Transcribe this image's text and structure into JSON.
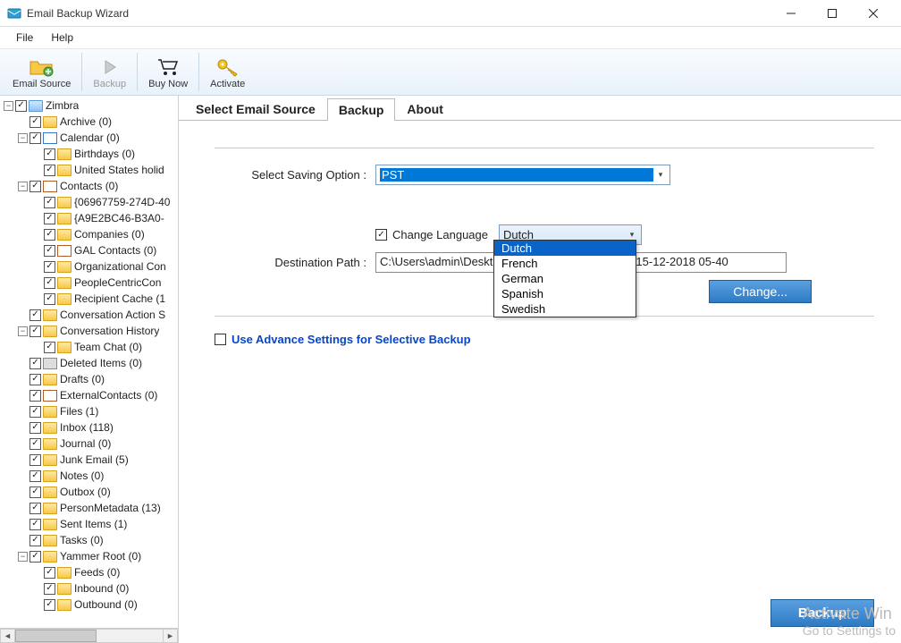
{
  "window": {
    "title": "Email Backup Wizard"
  },
  "menu": {
    "file": "File",
    "help": "Help"
  },
  "toolbar": {
    "email_source": "Email Source",
    "backup": "Backup",
    "buy_now": "Buy Now",
    "activate": "Activate"
  },
  "tree": [
    {
      "indent": 0,
      "exp": "-",
      "icon": "folder-blue",
      "label": "Zimbra"
    },
    {
      "indent": 1,
      "exp": " ",
      "icon": "folder",
      "label": "Archive (0)"
    },
    {
      "indent": 1,
      "exp": "-",
      "icon": "calendar",
      "label": "Calendar (0)"
    },
    {
      "indent": 2,
      "exp": " ",
      "icon": "folder",
      "label": "Birthdays (0)"
    },
    {
      "indent": 2,
      "exp": " ",
      "icon": "folder",
      "label": "United States holid"
    },
    {
      "indent": 1,
      "exp": "-",
      "icon": "contacts",
      "label": "Contacts (0)"
    },
    {
      "indent": 2,
      "exp": " ",
      "icon": "folder",
      "label": "{06967759-274D-40"
    },
    {
      "indent": 2,
      "exp": " ",
      "icon": "folder",
      "label": "{A9E2BC46-B3A0-"
    },
    {
      "indent": 2,
      "exp": " ",
      "icon": "folder",
      "label": "Companies (0)"
    },
    {
      "indent": 2,
      "exp": " ",
      "icon": "contacts",
      "label": "GAL Contacts (0)"
    },
    {
      "indent": 2,
      "exp": " ",
      "icon": "folder",
      "label": "Organizational Con"
    },
    {
      "indent": 2,
      "exp": " ",
      "icon": "folder",
      "label": "PeopleCentricCon"
    },
    {
      "indent": 2,
      "exp": " ",
      "icon": "folder",
      "label": "Recipient Cache (1"
    },
    {
      "indent": 1,
      "exp": " ",
      "icon": "folder",
      "label": "Conversation Action S"
    },
    {
      "indent": 1,
      "exp": "-",
      "icon": "folder",
      "label": "Conversation History"
    },
    {
      "indent": 2,
      "exp": " ",
      "icon": "folder",
      "label": "Team Chat (0)"
    },
    {
      "indent": 1,
      "exp": " ",
      "icon": "trash",
      "label": "Deleted Items (0)"
    },
    {
      "indent": 1,
      "exp": " ",
      "icon": "folder",
      "label": "Drafts (0)"
    },
    {
      "indent": 1,
      "exp": " ",
      "icon": "contacts",
      "label": "ExternalContacts (0)"
    },
    {
      "indent": 1,
      "exp": " ",
      "icon": "folder",
      "label": "Files (1)"
    },
    {
      "indent": 1,
      "exp": " ",
      "icon": "folder",
      "label": "Inbox (118)"
    },
    {
      "indent": 1,
      "exp": " ",
      "icon": "folder",
      "label": "Journal (0)"
    },
    {
      "indent": 1,
      "exp": " ",
      "icon": "folder",
      "label": "Junk Email (5)"
    },
    {
      "indent": 1,
      "exp": " ",
      "icon": "folder",
      "label": "Notes (0)"
    },
    {
      "indent": 1,
      "exp": " ",
      "icon": "folder",
      "label": "Outbox (0)"
    },
    {
      "indent": 1,
      "exp": " ",
      "icon": "folder",
      "label": "PersonMetadata (13)"
    },
    {
      "indent": 1,
      "exp": " ",
      "icon": "folder",
      "label": "Sent Items (1)"
    },
    {
      "indent": 1,
      "exp": " ",
      "icon": "folder",
      "label": "Tasks (0)"
    },
    {
      "indent": 1,
      "exp": "-",
      "icon": "folder",
      "label": "Yammer Root (0)"
    },
    {
      "indent": 2,
      "exp": " ",
      "icon": "folder",
      "label": "Feeds (0)"
    },
    {
      "indent": 2,
      "exp": " ",
      "icon": "folder",
      "label": "Inbound (0)"
    },
    {
      "indent": 2,
      "exp": " ",
      "icon": "folder",
      "label": "Outbound (0)"
    }
  ],
  "tabs": {
    "t1": "Select Email Source",
    "t2": "Backup",
    "t3": "About",
    "active": "t2"
  },
  "form": {
    "saving_label": "Select Saving Option :",
    "saving_value": "PST",
    "change_lang_label": "Change Language",
    "lang_value": "Dutch",
    "lang_options": [
      "Dutch",
      "French",
      "German",
      "Spanish",
      "Swedish"
    ],
    "dest_label": "Destination Path :",
    "dest_value_left": "C:\\Users\\admin\\Deskt",
    "dest_value_right": "15-12-2018 05-40",
    "change_btn": "Change...",
    "adv_label": "Use Advance Settings for Selective Backup",
    "backup_btn": "Backup"
  },
  "watermark": {
    "l1": "Activate Win",
    "l2": "Go to Settings to"
  }
}
